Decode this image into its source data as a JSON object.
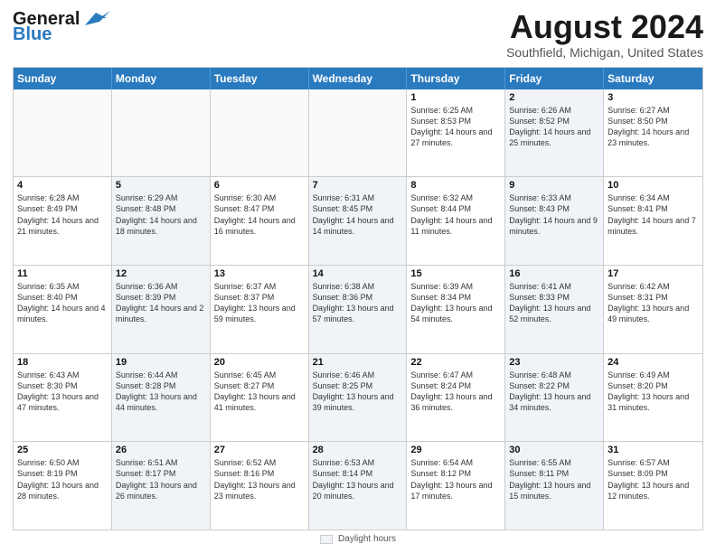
{
  "header": {
    "logo_line1": "General",
    "logo_line2": "Blue",
    "main_title": "August 2024",
    "subtitle": "Southfield, Michigan, United States"
  },
  "calendar": {
    "days_of_week": [
      "Sunday",
      "Monday",
      "Tuesday",
      "Wednesday",
      "Thursday",
      "Friday",
      "Saturday"
    ],
    "weeks": [
      [
        {
          "day": "",
          "text": "",
          "empty": true
        },
        {
          "day": "",
          "text": "",
          "empty": true
        },
        {
          "day": "",
          "text": "",
          "empty": true
        },
        {
          "day": "",
          "text": "",
          "empty": true
        },
        {
          "day": "1",
          "text": "Sunrise: 6:25 AM\nSunset: 8:53 PM\nDaylight: 14 hours and 27 minutes.",
          "empty": false,
          "shaded": false
        },
        {
          "day": "2",
          "text": "Sunrise: 6:26 AM\nSunset: 8:52 PM\nDaylight: 14 hours and 25 minutes.",
          "empty": false,
          "shaded": true
        },
        {
          "day": "3",
          "text": "Sunrise: 6:27 AM\nSunset: 8:50 PM\nDaylight: 14 hours and 23 minutes.",
          "empty": false,
          "shaded": false
        }
      ],
      [
        {
          "day": "4",
          "text": "Sunrise: 6:28 AM\nSunset: 8:49 PM\nDaylight: 14 hours and 21 minutes.",
          "empty": false,
          "shaded": false
        },
        {
          "day": "5",
          "text": "Sunrise: 6:29 AM\nSunset: 8:48 PM\nDaylight: 14 hours and 18 minutes.",
          "empty": false,
          "shaded": true
        },
        {
          "day": "6",
          "text": "Sunrise: 6:30 AM\nSunset: 8:47 PM\nDaylight: 14 hours and 16 minutes.",
          "empty": false,
          "shaded": false
        },
        {
          "day": "7",
          "text": "Sunrise: 6:31 AM\nSunset: 8:45 PM\nDaylight: 14 hours and 14 minutes.",
          "empty": false,
          "shaded": true
        },
        {
          "day": "8",
          "text": "Sunrise: 6:32 AM\nSunset: 8:44 PM\nDaylight: 14 hours and 11 minutes.",
          "empty": false,
          "shaded": false
        },
        {
          "day": "9",
          "text": "Sunrise: 6:33 AM\nSunset: 8:43 PM\nDaylight: 14 hours and 9 minutes.",
          "empty": false,
          "shaded": true
        },
        {
          "day": "10",
          "text": "Sunrise: 6:34 AM\nSunset: 8:41 PM\nDaylight: 14 hours and 7 minutes.",
          "empty": false,
          "shaded": false
        }
      ],
      [
        {
          "day": "11",
          "text": "Sunrise: 6:35 AM\nSunset: 8:40 PM\nDaylight: 14 hours and 4 minutes.",
          "empty": false,
          "shaded": false
        },
        {
          "day": "12",
          "text": "Sunrise: 6:36 AM\nSunset: 8:39 PM\nDaylight: 14 hours and 2 minutes.",
          "empty": false,
          "shaded": true
        },
        {
          "day": "13",
          "text": "Sunrise: 6:37 AM\nSunset: 8:37 PM\nDaylight: 13 hours and 59 minutes.",
          "empty": false,
          "shaded": false
        },
        {
          "day": "14",
          "text": "Sunrise: 6:38 AM\nSunset: 8:36 PM\nDaylight: 13 hours and 57 minutes.",
          "empty": false,
          "shaded": true
        },
        {
          "day": "15",
          "text": "Sunrise: 6:39 AM\nSunset: 8:34 PM\nDaylight: 13 hours and 54 minutes.",
          "empty": false,
          "shaded": false
        },
        {
          "day": "16",
          "text": "Sunrise: 6:41 AM\nSunset: 8:33 PM\nDaylight: 13 hours and 52 minutes.",
          "empty": false,
          "shaded": true
        },
        {
          "day": "17",
          "text": "Sunrise: 6:42 AM\nSunset: 8:31 PM\nDaylight: 13 hours and 49 minutes.",
          "empty": false,
          "shaded": false
        }
      ],
      [
        {
          "day": "18",
          "text": "Sunrise: 6:43 AM\nSunset: 8:30 PM\nDaylight: 13 hours and 47 minutes.",
          "empty": false,
          "shaded": false
        },
        {
          "day": "19",
          "text": "Sunrise: 6:44 AM\nSunset: 8:28 PM\nDaylight: 13 hours and 44 minutes.",
          "empty": false,
          "shaded": true
        },
        {
          "day": "20",
          "text": "Sunrise: 6:45 AM\nSunset: 8:27 PM\nDaylight: 13 hours and 41 minutes.",
          "empty": false,
          "shaded": false
        },
        {
          "day": "21",
          "text": "Sunrise: 6:46 AM\nSunset: 8:25 PM\nDaylight: 13 hours and 39 minutes.",
          "empty": false,
          "shaded": true
        },
        {
          "day": "22",
          "text": "Sunrise: 6:47 AM\nSunset: 8:24 PM\nDaylight: 13 hours and 36 minutes.",
          "empty": false,
          "shaded": false
        },
        {
          "day": "23",
          "text": "Sunrise: 6:48 AM\nSunset: 8:22 PM\nDaylight: 13 hours and 34 minutes.",
          "empty": false,
          "shaded": true
        },
        {
          "day": "24",
          "text": "Sunrise: 6:49 AM\nSunset: 8:20 PM\nDaylight: 13 hours and 31 minutes.",
          "empty": false,
          "shaded": false
        }
      ],
      [
        {
          "day": "25",
          "text": "Sunrise: 6:50 AM\nSunset: 8:19 PM\nDaylight: 13 hours and 28 minutes.",
          "empty": false,
          "shaded": false
        },
        {
          "day": "26",
          "text": "Sunrise: 6:51 AM\nSunset: 8:17 PM\nDaylight: 13 hours and 26 minutes.",
          "empty": false,
          "shaded": true
        },
        {
          "day": "27",
          "text": "Sunrise: 6:52 AM\nSunset: 8:16 PM\nDaylight: 13 hours and 23 minutes.",
          "empty": false,
          "shaded": false
        },
        {
          "day": "28",
          "text": "Sunrise: 6:53 AM\nSunset: 8:14 PM\nDaylight: 13 hours and 20 minutes.",
          "empty": false,
          "shaded": true
        },
        {
          "day": "29",
          "text": "Sunrise: 6:54 AM\nSunset: 8:12 PM\nDaylight: 13 hours and 17 minutes.",
          "empty": false,
          "shaded": false
        },
        {
          "day": "30",
          "text": "Sunrise: 6:55 AM\nSunset: 8:11 PM\nDaylight: 13 hours and 15 minutes.",
          "empty": false,
          "shaded": true
        },
        {
          "day": "31",
          "text": "Sunrise: 6:57 AM\nSunset: 8:09 PM\nDaylight: 13 hours and 12 minutes.",
          "empty": false,
          "shaded": false
        }
      ]
    ]
  },
  "footer": {
    "swatch_label": "Daylight hours"
  }
}
